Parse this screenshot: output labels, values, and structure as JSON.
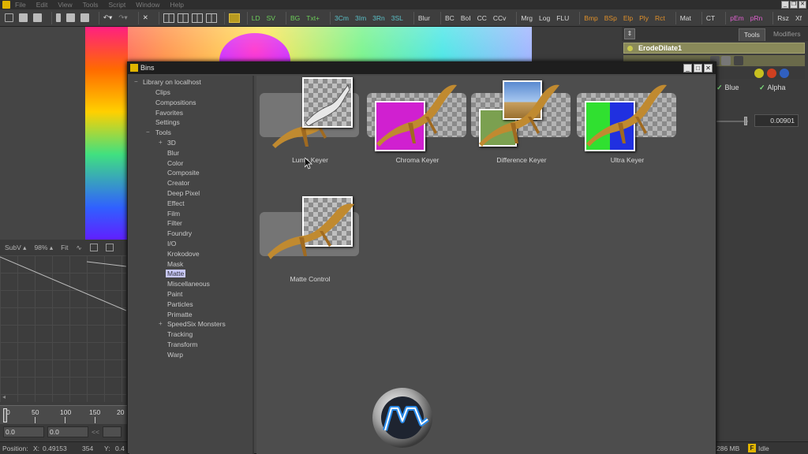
{
  "menubar": {
    "items": [
      "File",
      "Edit",
      "View",
      "Tools",
      "Script",
      "Window",
      "Help"
    ]
  },
  "toolbar": {
    "tools": [
      "LD",
      "SV",
      "BG",
      "Txt+",
      "3Cm",
      "3Im",
      "3Rn",
      "3SL",
      "Blur",
      "BC",
      "BoI",
      "CC",
      "CCv",
      "Mrg",
      "Log",
      "FLU",
      "Bmp",
      "BSp",
      "Elp",
      "Ply",
      "Rct",
      "Mat",
      "CT",
      "pEm",
      "pRn",
      "Rsz",
      "Xf"
    ],
    "colors": {
      "green": "#6ccf5a",
      "teal": "#5ac0c8",
      "orange": "#e0902a",
      "white": "#d8d8d8",
      "pink": "#e060d0"
    }
  },
  "subview": {
    "mode": "SubV",
    "zoom": "98%",
    "fit": "Fit"
  },
  "timeline": {
    "ticks": [
      "0",
      "50",
      "100",
      "150",
      "20"
    ],
    "start_field": "0.0",
    "end_field": "0.0",
    "nav": "<<"
  },
  "statusbar": {
    "position_label": "Position:",
    "x_label": "X:",
    "x_value": "0.49153",
    "px": "354",
    "y_label": "Y:",
    "y_value": "0.4",
    "memory": "286 MB",
    "state": "Idle"
  },
  "rightpane": {
    "tabs": [
      "Tools",
      "Modifiers"
    ],
    "node_name": "ErodeDilate1",
    "channels": [
      "Blue",
      "Alpha"
    ],
    "value": "0.00901"
  },
  "bins": {
    "title": "Bins",
    "tree": {
      "root": "Library on localhost",
      "top_items": [
        "Clips",
        "Compositions",
        "Favorites",
        "Settings",
        "Tools"
      ],
      "tools_children": [
        "3D",
        "Blur",
        "Color",
        "Composite",
        "Creator",
        "Deep Pixel",
        "Effect",
        "Film",
        "Filter",
        "Foundry",
        "I/O",
        "Krokodove",
        "Mask",
        "Matte",
        "Miscellaneous",
        "Paint",
        "Particles",
        "Primatte",
        "SpeedSix Monsters",
        "Tracking",
        "Transform",
        "Warp"
      ],
      "selected": "Matte"
    },
    "items": [
      {
        "label": "Luma Keyer"
      },
      {
        "label": "Chroma Keyer"
      },
      {
        "label": "Difference Keyer"
      },
      {
        "label": "Ultra Keyer"
      },
      {
        "label": "Matte Control"
      }
    ]
  }
}
